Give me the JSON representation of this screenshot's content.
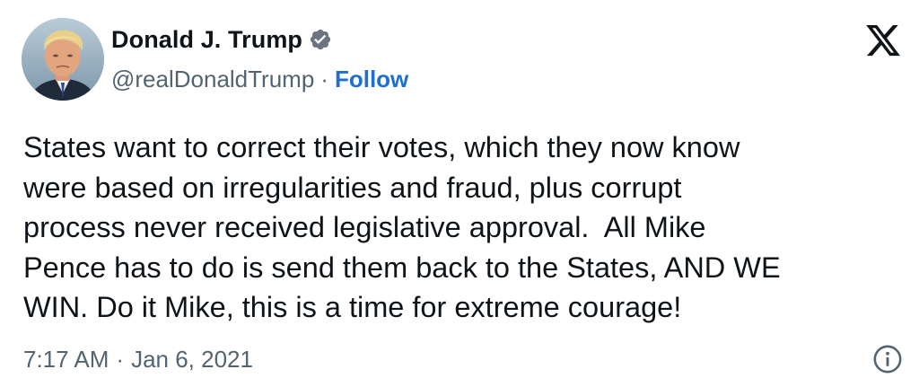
{
  "author": {
    "display_name": "Donald J. Trump",
    "handle": "@realDonaldTrump",
    "separator": "·",
    "follow_label": "Follow",
    "verified_icon": "verified-badge-icon",
    "avatar_icon": "avatar"
  },
  "tweet": {
    "text": "States want to correct their votes, which they now know\nwere based on irregularities and fraud, plus corrupt\nprocess never received legislative approval.  All Mike\nPence has to do is send them back to the States, AND WE\nWIN. Do it Mike, this is a time for extreme courage!"
  },
  "meta": {
    "time": "7:17 AM",
    "separator": "·",
    "date": "Jan 6, 2021"
  },
  "icons": {
    "platform_logo": "x-logo-icon",
    "info": "info-icon"
  },
  "colors": {
    "text": "#0f1419",
    "secondary": "#536471",
    "link": "#1d6fd1"
  }
}
